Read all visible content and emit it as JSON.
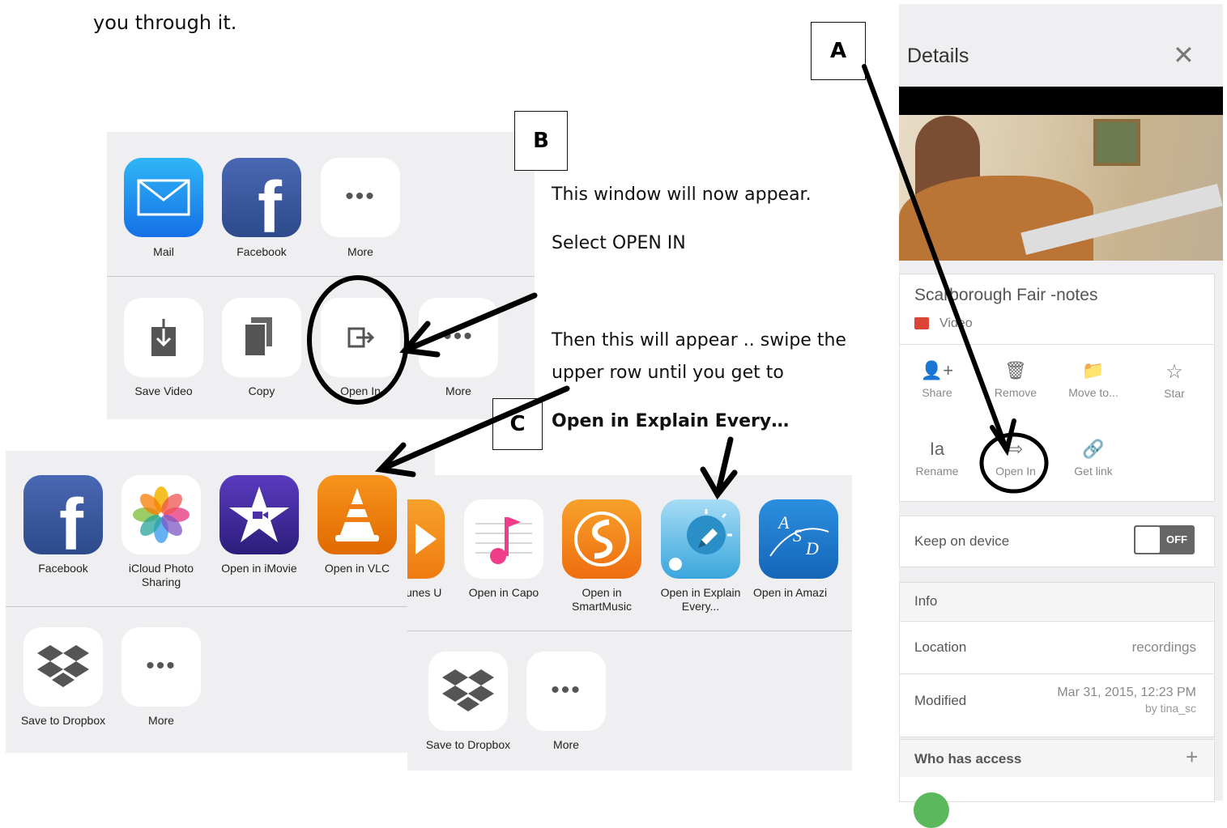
{
  "doc": {
    "top_line": "you through it.",
    "line1": "This window will now appear.",
    "line2": "Select OPEN IN",
    "line3": "Then this will appear .. swipe the",
    "line4": "upper row until you get to",
    "line5": "Open in Explain Every…"
  },
  "labels": {
    "a": "A",
    "b": "B",
    "c": "C"
  },
  "sheet_b": {
    "row1": [
      {
        "label": "Mail",
        "icon": "mail-icon"
      },
      {
        "label": "Facebook",
        "icon": "facebook-icon"
      },
      {
        "label": "More",
        "icon": "more-icon"
      }
    ],
    "row2": [
      {
        "label": "Save Video",
        "icon": "save-video-icon"
      },
      {
        "label": "Copy",
        "icon": "copy-icon"
      },
      {
        "label": "Open In",
        "icon": "open-in-icon"
      },
      {
        "label": "More",
        "icon": "more-icon"
      }
    ]
  },
  "sheet_c1": {
    "row1": [
      {
        "label": "Facebook",
        "icon": "facebook-icon"
      },
      {
        "label": "iCloud Photo Sharing",
        "icon": "photos-icon"
      },
      {
        "label": "Open in iMovie",
        "icon": "imovie-icon"
      },
      {
        "label": "Open in VLC",
        "icon": "vlc-icon"
      }
    ],
    "row2": [
      {
        "label": "Save to Dropbox",
        "icon": "dropbox-icon"
      },
      {
        "label": "More",
        "icon": "more-icon"
      }
    ]
  },
  "sheet_c2": {
    "row1": [
      {
        "label": "iTunes U",
        "icon": "itunes-u-icon"
      },
      {
        "label": "Open in Capo",
        "icon": "capo-icon"
      },
      {
        "label": "Open in SmartMusic",
        "icon": "smartmusic-icon"
      },
      {
        "label": "Open in Explain Every...",
        "icon": "explain-everything-icon"
      },
      {
        "label": "Open in Amazi",
        "icon": "asd-icon"
      }
    ],
    "row2": [
      {
        "label": "Save to Dropbox",
        "icon": "dropbox-icon"
      },
      {
        "label": "More",
        "icon": "more-icon"
      }
    ]
  },
  "details": {
    "title": "Details",
    "file_name": "Scarborough Fair -notes",
    "file_type": "Video",
    "actions_row1": [
      "Share",
      "Remove",
      "Move to...",
      "Star"
    ],
    "actions_row2": [
      "Rename",
      "Open In",
      "Get link"
    ],
    "keep_on_device": "Keep on device",
    "toggle": "OFF",
    "info_header": "Info",
    "location_label": "Location",
    "location_value": "recordings",
    "modified_label": "Modified",
    "modified_value": "Mar 31, 2015, 12:23 PM",
    "modified_by": "by tina_sc",
    "access_header": "Who has access"
  },
  "colors": {
    "facebook": "#3b5998",
    "mail": "#1e90ff",
    "vlc": "#f07d12",
    "imovie": "#4d2fa8",
    "smartmusic": "#f28a1a",
    "explain": "#3aa6dd",
    "asd": "#1c79c6",
    "drive_red": "#db4437"
  }
}
